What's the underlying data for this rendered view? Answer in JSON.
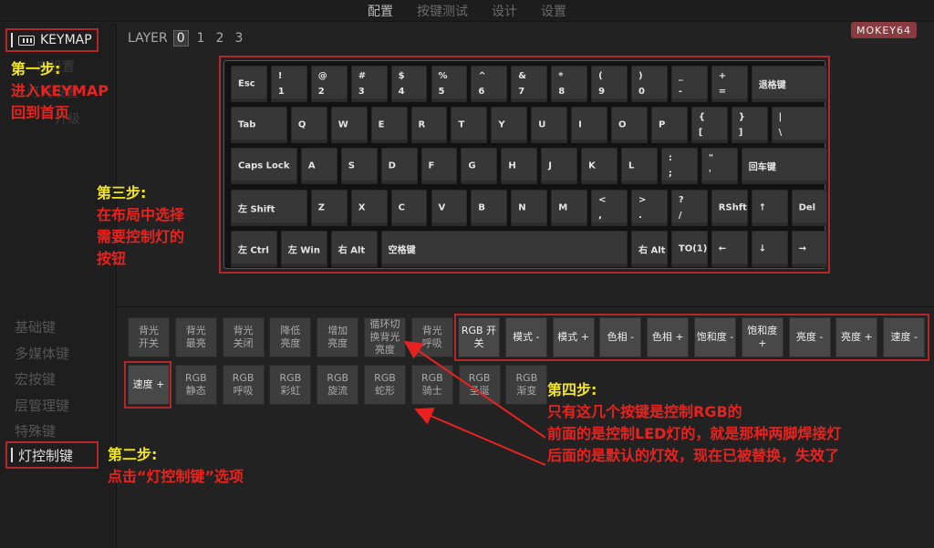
{
  "nav": {
    "tabs": [
      "配置",
      "按键测试",
      "设计",
      "设置"
    ],
    "active": 0
  },
  "sidebar": {
    "keymap_label": "KEYMAP",
    "ghost_items": [
      "宏设置",
      "灯光设置",
      "升级"
    ],
    "categories": [
      "基础键",
      "多媒体键",
      "宏按键",
      "层管理键",
      "特殊键"
    ],
    "light_label": "灯控制键"
  },
  "layer": {
    "label": "LAYER",
    "numbers": [
      "0",
      "1",
      "2",
      "3"
    ],
    "active": 0
  },
  "model_badge": "MOKEY64",
  "keyboard": {
    "rows": [
      [
        {
          "m": "Esc",
          "w": 1
        },
        {
          "t": "!",
          "b": "1",
          "w": 1
        },
        {
          "t": "@",
          "b": "2",
          "w": 1
        },
        {
          "t": "#",
          "b": "3",
          "w": 1
        },
        {
          "t": "$",
          "b": "4",
          "w": 1
        },
        {
          "t": "%",
          "b": "5",
          "w": 1
        },
        {
          "t": "^",
          "b": "6",
          "w": 1
        },
        {
          "t": "&",
          "b": "7",
          "w": 1
        },
        {
          "t": "*",
          "b": "8",
          "w": 1
        },
        {
          "t": "(",
          "b": "9",
          "w": 1
        },
        {
          "t": ")",
          "b": "0",
          "w": 1
        },
        {
          "t": "_",
          "b": "-",
          "w": 1
        },
        {
          "t": "+",
          "b": "=",
          "w": 1
        },
        {
          "m": "退格键",
          "w": 2
        }
      ],
      [
        {
          "m": "Tab",
          "w": 1.5
        },
        {
          "m": "Q",
          "w": 1
        },
        {
          "m": "W",
          "w": 1
        },
        {
          "m": "E",
          "w": 1
        },
        {
          "m": "R",
          "w": 1
        },
        {
          "m": "T",
          "w": 1
        },
        {
          "m": "Y",
          "w": 1
        },
        {
          "m": "U",
          "w": 1
        },
        {
          "m": "I",
          "w": 1
        },
        {
          "m": "O",
          "w": 1
        },
        {
          "m": "P",
          "w": 1
        },
        {
          "t": "{",
          "b": "[",
          "w": 1
        },
        {
          "t": "}",
          "b": "]",
          "w": 1
        },
        {
          "t": "|",
          "b": "\\",
          "w": 1.5
        }
      ],
      [
        {
          "m": "Caps Lock",
          "w": 1.75
        },
        {
          "m": "A",
          "w": 1
        },
        {
          "m": "S",
          "w": 1
        },
        {
          "m": "D",
          "w": 1
        },
        {
          "m": "F",
          "w": 1
        },
        {
          "m": "G",
          "w": 1
        },
        {
          "m": "H",
          "w": 1
        },
        {
          "m": "J",
          "w": 1
        },
        {
          "m": "K",
          "w": 1
        },
        {
          "m": "L",
          "w": 1
        },
        {
          "t": ":",
          "b": ";",
          "w": 1
        },
        {
          "t": "\"",
          "b": "'",
          "w": 1
        },
        {
          "m": "回车键",
          "w": 2.25
        }
      ],
      [
        {
          "m": "左 Shift",
          "w": 2
        },
        {
          "m": "Z",
          "w": 1
        },
        {
          "m": "X",
          "w": 1
        },
        {
          "m": "C",
          "w": 1
        },
        {
          "m": "V",
          "w": 1
        },
        {
          "m": "B",
          "w": 1
        },
        {
          "m": "N",
          "w": 1
        },
        {
          "m": "M",
          "w": 1
        },
        {
          "t": "<",
          "b": ",",
          "w": 1
        },
        {
          "t": ">",
          "b": ".",
          "w": 1
        },
        {
          "t": "?",
          "b": "/",
          "w": 1
        },
        {
          "m": "RShft",
          "w": 1
        },
        {
          "m": "↑",
          "w": 1
        },
        {
          "m": "Del",
          "w": 1
        }
      ],
      [
        {
          "m": "左 Ctrl",
          "w": 1.25
        },
        {
          "m": "左 Win",
          "w": 1.25
        },
        {
          "m": "右 Alt",
          "w": 1.25
        },
        {
          "m": "空格键",
          "w": 6.25
        },
        {
          "m": "右 Alt",
          "w": 1
        },
        {
          "m": "TO(1)",
          "w": 1
        },
        {
          "m": "←",
          "w": 1
        },
        {
          "m": "↓",
          "w": 1
        },
        {
          "m": "→",
          "w": 1
        }
      ]
    ]
  },
  "light_keys": {
    "row1_led": [
      "背光 开关",
      "背光 最亮",
      "背光 关闭",
      "降低 亮度",
      "增加 亮度",
      "循环切换背光亮度",
      "背光 呼吸"
    ],
    "row1_rgb": [
      "RGB 开关",
      "模式 -",
      "模式 +",
      "色相 -",
      "色相 +",
      "饱和度 -",
      "饱和度 +",
      "亮度 -",
      "亮度 +",
      "速度 -"
    ],
    "row2": [
      "速度 +",
      "RGB 静态",
      "RGB 呼吸",
      "RGB 彩虹",
      "RGB 旋流",
      "RGB 蛇形",
      "RGB 骑士",
      "RGB 圣诞",
      "RGB 渐变"
    ]
  },
  "annotations": {
    "step1": [
      "第一步:",
      "进入KEYMAP",
      "回到首页"
    ],
    "step2": [
      "第二步:",
      "点击“灯控制键”选项"
    ],
    "step3": [
      "第三步:",
      "在布局中选择",
      "需要控制灯的",
      "按钮"
    ],
    "step4": [
      "第四步:",
      "只有这几个按键是控制RGB的",
      "前面的是控制LED灯的，就是那种两脚焊接灯",
      "后面的是默认的灯效，现在已被替换，失效了"
    ]
  },
  "colors": {
    "accent_red": "#b3262a",
    "note_yellow": "#f2e51b",
    "note_red": "#e8231f",
    "badge": "#8a3b40"
  }
}
